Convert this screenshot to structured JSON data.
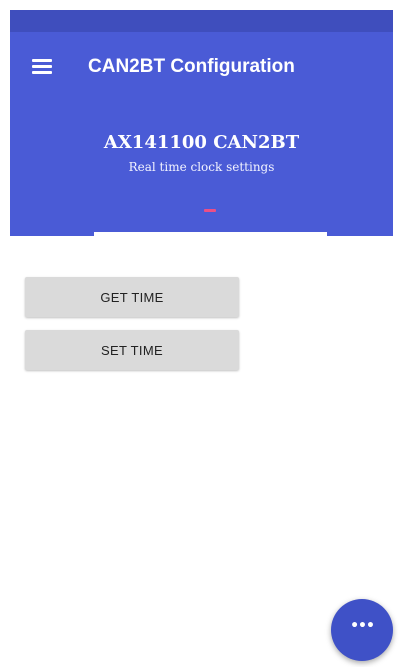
{
  "app_bar": {
    "title": "CAN2BT Configuration",
    "menu_icon": "hamburger-menu-icon",
    "background_color": "#4a5bd6",
    "status_bar_color": "#3f4ebd"
  },
  "header": {
    "device_name": "AX141100 CAN2BT",
    "subtitle": "Real time clock settings",
    "page_indicator_color": "#ec4f86"
  },
  "actions": {
    "get_time_label": "GET TIME",
    "set_time_label": "SET TIME"
  },
  "fab": {
    "icon": "more-horiz-icon",
    "glyph": "•••",
    "color": "#3f51c7"
  }
}
